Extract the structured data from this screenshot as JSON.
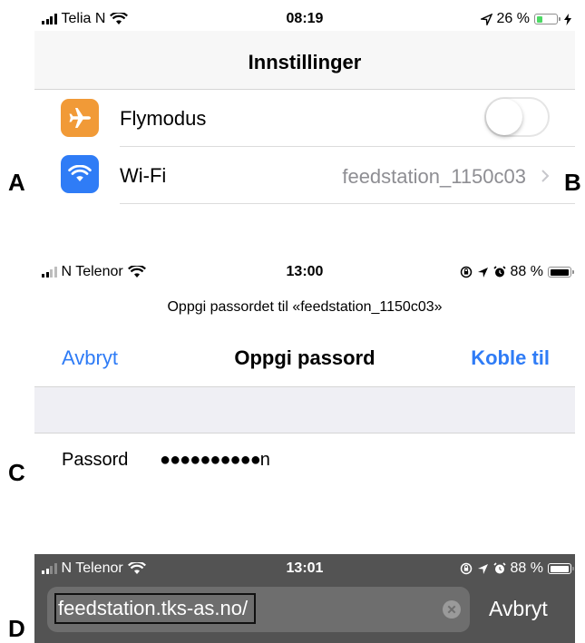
{
  "labels": {
    "a": "A",
    "b": "B",
    "c": "C",
    "d": "D"
  },
  "panel_a": {
    "status": {
      "carrier": "Telia N",
      "time": "08:19",
      "battery": "26 %",
      "signal_bars": 4,
      "battery_level": 0.26
    },
    "title": "Innstillinger",
    "flymodus": {
      "label": "Flymodus",
      "toggle_on": false
    },
    "wifi": {
      "label": "Wi-Fi",
      "value": "feedstation_1150c03"
    },
    "colors": {
      "airplane": "#f19a37",
      "wifi": "#2f7cf6"
    }
  },
  "panel_c": {
    "status": {
      "carrier": "N Telenor",
      "time": "13:00",
      "battery": "88 %",
      "signal_bars": 2,
      "battery_level": 0.88
    },
    "prompt": "Oppgi passordet til «feedstation_1150c03»",
    "cancel": "Avbryt",
    "title": "Oppgi passord",
    "connect": "Koble til",
    "password_label": "Passord",
    "password_value": "●●●●●●●●●●n",
    "accent": "#2f7cf6"
  },
  "panel_d": {
    "status": {
      "carrier": "N Telenor",
      "time": "13:01",
      "battery": "88 %",
      "signal_bars": 2,
      "battery_level": 0.88
    },
    "url": "feedstation.tks-as.no/",
    "cancel": "Avbryt"
  }
}
